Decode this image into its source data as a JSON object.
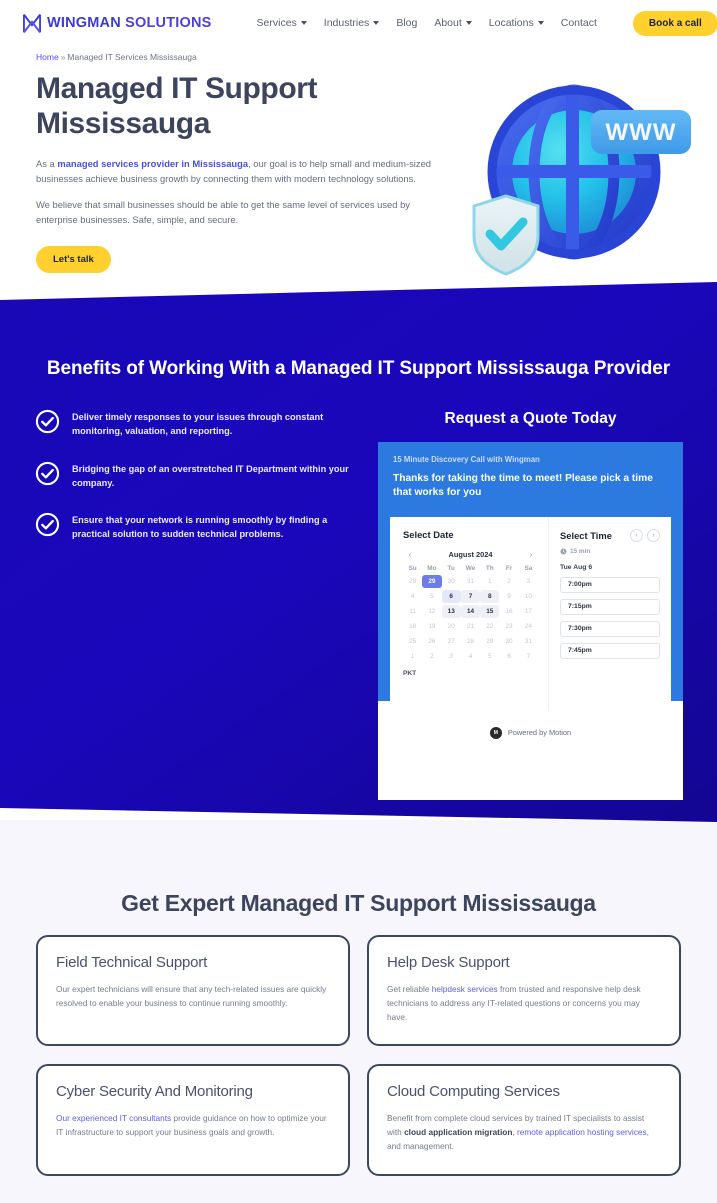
{
  "header": {
    "logo": {
      "part1": "WINGMAN",
      "part2": "SOLUTIONS",
      "icon": "wingman-m-logo"
    },
    "nav": [
      {
        "label": "Services",
        "has_dropdown": true
      },
      {
        "label": "Industries",
        "has_dropdown": true
      },
      {
        "label": "Blog",
        "has_dropdown": false
      },
      {
        "label": "About",
        "has_dropdown": true
      },
      {
        "label": "Locations",
        "has_dropdown": true
      },
      {
        "label": "Contact",
        "has_dropdown": false
      }
    ],
    "cta": "Book a call",
    "cta_color": "#ffd02e"
  },
  "breadcrumb": {
    "home": "Home",
    "separator": "»",
    "current": "Managed IT Services Mississauga"
  },
  "hero": {
    "title": "Managed IT Support Mississauga",
    "paragraph1_pre": "As a ",
    "paragraph1_link": "managed services provider in Mississauga",
    "paragraph1_post": ", our goal is to help small and medium-sized businesses achieve business growth by connecting them with modern technology solutions.",
    "paragraph2": "We believe that small businesses should be able to get the same level of services used by enterprise businesses. Safe, simple, and secure.",
    "button": "Let's talk",
    "illustration": "globe-www-shield-illustration",
    "illustration_label": "WWW"
  },
  "benefits": {
    "title": "Benefits of Working With a Managed IT Support Mississauga Provider",
    "background_color": "#1a07b8",
    "items": [
      "Deliver timely responses to your issues through constant monitoring, valuation, and reporting.",
      "Bridging the gap of an overstretched IT Department within your company.",
      "Ensure that your network is running smoothly by finding a practical solution to sudden technical problems."
    ]
  },
  "booking": {
    "heading": "Request a Quote Today",
    "event_name": "15 Minute Discovery Call with Wingman",
    "intro": "Thanks for taking the time to meet! Please pick a time that works for you",
    "select_date_label": "Select Date",
    "month": "August 2024",
    "prev_arrow": "‹",
    "next_arrow": "›",
    "weekdays": [
      "Su",
      "Mo",
      "Tu",
      "We",
      "Th",
      "Fr",
      "Sa"
    ],
    "days": [
      {
        "n": "28",
        "state": "muted"
      },
      {
        "n": "29",
        "state": "selected"
      },
      {
        "n": "30",
        "state": "muted"
      },
      {
        "n": "31",
        "state": "muted"
      },
      {
        "n": "1",
        "state": "muted"
      },
      {
        "n": "2",
        "state": "muted"
      },
      {
        "n": "3",
        "state": "muted"
      },
      {
        "n": "4",
        "state": "muted"
      },
      {
        "n": "5",
        "state": "muted"
      },
      {
        "n": "6",
        "state": "highlight"
      },
      {
        "n": "7",
        "state": "available"
      },
      {
        "n": "8",
        "state": "available"
      },
      {
        "n": "9",
        "state": "muted"
      },
      {
        "n": "10",
        "state": "muted"
      },
      {
        "n": "11",
        "state": "muted"
      },
      {
        "n": "12",
        "state": "muted"
      },
      {
        "n": "13",
        "state": "available"
      },
      {
        "n": "14",
        "state": "available"
      },
      {
        "n": "15",
        "state": "available"
      },
      {
        "n": "16",
        "state": "muted"
      },
      {
        "n": "17",
        "state": "muted"
      },
      {
        "n": "18",
        "state": "muted"
      },
      {
        "n": "19",
        "state": "muted"
      },
      {
        "n": "20",
        "state": "muted"
      },
      {
        "n": "21",
        "state": "muted"
      },
      {
        "n": "22",
        "state": "muted"
      },
      {
        "n": "23",
        "state": "muted"
      },
      {
        "n": "24",
        "state": "muted"
      },
      {
        "n": "25",
        "state": "muted"
      },
      {
        "n": "26",
        "state": "muted"
      },
      {
        "n": "27",
        "state": "muted"
      },
      {
        "n": "28",
        "state": "muted"
      },
      {
        "n": "29",
        "state": "muted"
      },
      {
        "n": "30",
        "state": "muted"
      },
      {
        "n": "31",
        "state": "muted"
      },
      {
        "n": "1",
        "state": "muted"
      },
      {
        "n": "2",
        "state": "muted"
      },
      {
        "n": "3",
        "state": "muted"
      },
      {
        "n": "4",
        "state": "muted"
      },
      {
        "n": "5",
        "state": "muted"
      },
      {
        "n": "6",
        "state": "muted"
      },
      {
        "n": "7",
        "state": "muted"
      }
    ],
    "timezone": "PKT",
    "select_time_label": "Select Time",
    "duration": "15 min",
    "selected_day": "Tue Aug 6",
    "slots": [
      "7:00pm",
      "7:15pm",
      "7:30pm",
      "7:45pm"
    ],
    "footer_text": "Powered by Motion",
    "footer_logo": "motion-logo"
  },
  "services": {
    "title": "Get Expert Managed IT Support Mississauga",
    "cards": [
      {
        "title": "Field Technical Support",
        "body": "Our expert technicians will ensure that any tech-related issues are quickly resolved to enable your business to continue running smoothly."
      },
      {
        "title": "Help Desk Support",
        "body_pre": "Get reliable ",
        "body_link": "helpdesk services",
        "body_post": " from trusted and responsive help desk technicians to address any IT-related questions or concerns you may have."
      },
      {
        "title": "Cyber Security And Monitoring",
        "body_link": "Our experienced IT consultants",
        "body_post": " provide guidance on how to optimize your IT infrastructure to support your business goals and growth."
      },
      {
        "title": "Cloud Computing Services",
        "body_pre": "Benefit from complete cloud services by trained IT specialists to assist with ",
        "body_bold": "cloud application migration",
        "body_mid": ", ",
        "body_link": "remote application hosting services",
        "body_post": ", and management."
      }
    ]
  }
}
